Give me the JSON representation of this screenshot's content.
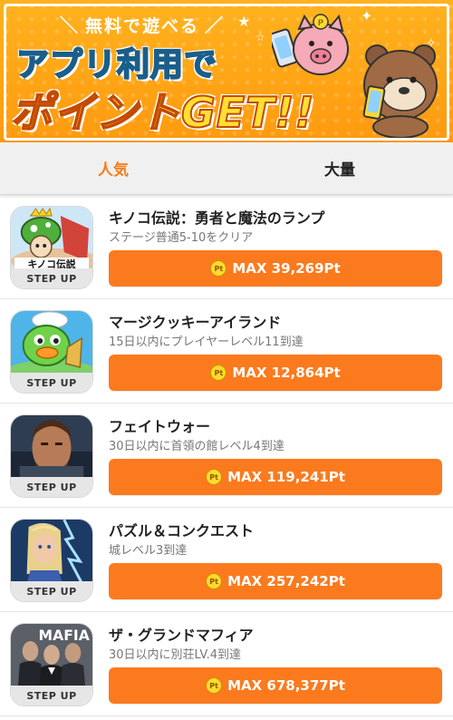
{
  "banner": {
    "subtitle": "無料で遊べる",
    "line1": "アプリ利用で",
    "line2": "ポイントGET!!"
  },
  "tabs": [
    {
      "label": "人気",
      "active": true
    },
    {
      "label": "大量",
      "active": false
    }
  ],
  "apps": [
    {
      "title": "キノコ伝説：勇者と魔法のランプ",
      "desc": "ステージ普通5-10をクリア",
      "badge": "STEP UP",
      "reward": "MAX 39,269Pt",
      "icon_text": "キノコ伝説"
    },
    {
      "title": "マージクッキーアイランド",
      "desc": "15日以内にプレイヤーレベル11到達",
      "badge": "STEP UP",
      "reward": "MAX 12,864Pt"
    },
    {
      "title": "フェイトウォー",
      "desc": "30日以内に首領の館レベル4到達",
      "badge": "STEP UP",
      "reward": "MAX 119,241Pt"
    },
    {
      "title": "パズル＆コンクエスト",
      "desc": "城レベル3到達",
      "badge": "STEP UP",
      "reward": "MAX 257,242Pt"
    },
    {
      "title": "ザ・グランドマフィア",
      "desc": "30日以内に別荘LV.4到達",
      "badge": "STEP UP",
      "reward": "MAX 678,377Pt",
      "icon_text": "MAFIA"
    }
  ],
  "coin_label": "Pt",
  "colors": {
    "accent": "#f57c18",
    "button": "#fb7a1e",
    "banner": "#ffa514"
  }
}
